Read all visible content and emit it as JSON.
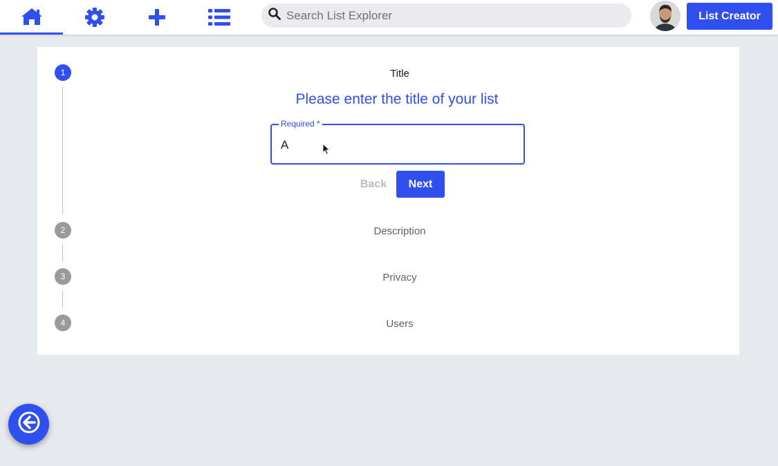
{
  "nav": {
    "items": [
      {
        "icon": "home-icon",
        "active": true
      },
      {
        "icon": "gear-icon",
        "active": false
      },
      {
        "icon": "plus-icon",
        "active": false
      },
      {
        "icon": "list-icon",
        "active": false
      }
    ]
  },
  "search": {
    "placeholder": "Search List Explorer"
  },
  "header": {
    "creator_label": "List Creator"
  },
  "stepper": {
    "steps": [
      {
        "number": "1",
        "label": "Title",
        "state": "active"
      },
      {
        "number": "2",
        "label": "Description",
        "state": "inactive"
      },
      {
        "number": "3",
        "label": "Privacy",
        "state": "inactive"
      },
      {
        "number": "4",
        "label": "Users",
        "state": "inactive"
      }
    ],
    "prompt": "Please enter the title of your list",
    "field": {
      "legend": "Required *",
      "value": "A"
    },
    "back_label": "Back",
    "next_label": "Next"
  },
  "colors": {
    "accent": "#2f4ff0",
    "inactive_step": "#9a9a9a",
    "background": "#e6e9ee"
  }
}
